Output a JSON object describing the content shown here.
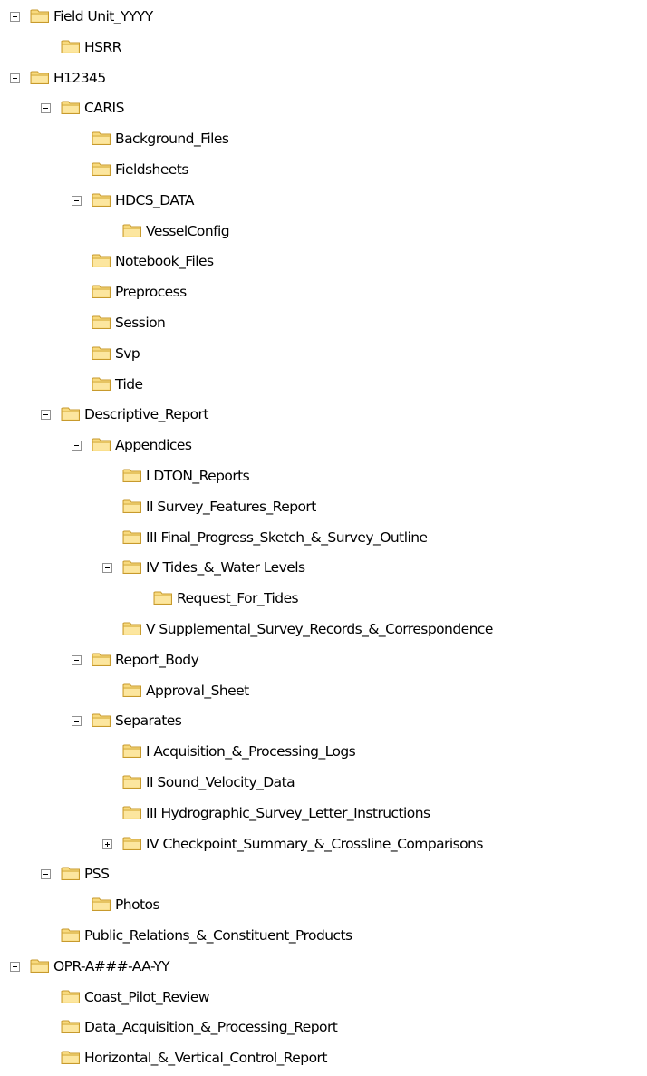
{
  "tree": [
    {
      "depth": 0,
      "state": "expanded",
      "label": "Field Unit_YYYY",
      "icon": "folder-icon"
    },
    {
      "depth": 1,
      "state": "leaf",
      "label": "HSRR",
      "icon": "folder-icon"
    },
    {
      "depth": 0,
      "state": "expanded",
      "label": "H12345",
      "icon": "folder-icon"
    },
    {
      "depth": 1,
      "state": "expanded",
      "label": "CARIS",
      "icon": "folder-icon"
    },
    {
      "depth": 2,
      "state": "leaf",
      "label": "Background_Files",
      "icon": "folder-icon"
    },
    {
      "depth": 2,
      "state": "leaf",
      "label": "Fieldsheets",
      "icon": "folder-icon"
    },
    {
      "depth": 2,
      "state": "expanded",
      "label": "HDCS_DATA",
      "icon": "folder-icon"
    },
    {
      "depth": 3,
      "state": "leaf",
      "label": "VesselConfig",
      "icon": "folder-icon"
    },
    {
      "depth": 2,
      "state": "leaf",
      "label": "Notebook_Files",
      "icon": "folder-icon"
    },
    {
      "depth": 2,
      "state": "leaf",
      "label": "Preprocess",
      "icon": "folder-icon"
    },
    {
      "depth": 2,
      "state": "leaf",
      "label": "Session",
      "icon": "folder-icon"
    },
    {
      "depth": 2,
      "state": "leaf",
      "label": "Svp",
      "icon": "folder-icon"
    },
    {
      "depth": 2,
      "state": "leaf",
      "label": "Tide",
      "icon": "folder-icon"
    },
    {
      "depth": 1,
      "state": "expanded",
      "label": "Descriptive_Report",
      "icon": "folder-icon"
    },
    {
      "depth": 2,
      "state": "expanded",
      "label": "Appendices",
      "icon": "folder-icon"
    },
    {
      "depth": 3,
      "state": "leaf",
      "label": "I DTON_Reports",
      "icon": "folder-icon"
    },
    {
      "depth": 3,
      "state": "leaf",
      "label": "II Survey_Features_Report",
      "icon": "folder-icon"
    },
    {
      "depth": 3,
      "state": "leaf",
      "label": "III Final_Progress_Sketch_&_Survey_Outline",
      "icon": "folder-icon"
    },
    {
      "depth": 3,
      "state": "expanded",
      "label": "IV Tides_&_Water Levels",
      "icon": "folder-icon"
    },
    {
      "depth": 4,
      "state": "leaf",
      "label": "Request_For_Tides",
      "icon": "folder-icon"
    },
    {
      "depth": 3,
      "state": "leaf",
      "label": "V Supplemental_Survey_Records_&_Correspondence",
      "icon": "folder-icon"
    },
    {
      "depth": 2,
      "state": "expanded",
      "label": "Report_Body",
      "icon": "folder-icon"
    },
    {
      "depth": 3,
      "state": "leaf",
      "label": "Approval_Sheet",
      "icon": "folder-icon"
    },
    {
      "depth": 2,
      "state": "expanded",
      "label": "Separates",
      "icon": "folder-icon"
    },
    {
      "depth": 3,
      "state": "leaf",
      "label": "I Acquisition_&_Processing_Logs",
      "icon": "folder-icon"
    },
    {
      "depth": 3,
      "state": "leaf",
      "label": "II Sound_Velocity_Data",
      "icon": "folder-icon"
    },
    {
      "depth": 3,
      "state": "leaf",
      "label": "III Hydrographic_Survey_Letter_Instructions",
      "icon": "folder-icon"
    },
    {
      "depth": 3,
      "state": "collapsed",
      "label": "IV Checkpoint_Summary_&_Crossline_Comparisons",
      "icon": "folder-icon"
    },
    {
      "depth": 1,
      "state": "expanded",
      "label": "PSS",
      "icon": "folder-icon"
    },
    {
      "depth": 2,
      "state": "leaf",
      "label": "Photos",
      "icon": "folder-icon"
    },
    {
      "depth": 1,
      "state": "leaf",
      "label": "Public_Relations_&_Constituent_Products",
      "icon": "folder-icon"
    },
    {
      "depth": 0,
      "state": "expanded",
      "label": "OPR-A###-AA-YY",
      "icon": "folder-icon"
    },
    {
      "depth": 1,
      "state": "leaf",
      "label": "Coast_Pilot_Review",
      "icon": "folder-icon"
    },
    {
      "depth": 1,
      "state": "leaf",
      "label": "Data_Acquisition_&_Processing_Report",
      "icon": "folder-icon"
    },
    {
      "depth": 1,
      "state": "leaf",
      "label": "Horizontal_&_Vertical_Control_Report",
      "icon": "folder-icon"
    }
  ],
  "colors": {
    "folder_fill": "#F8DA7E",
    "folder_outline": "#C79A2D",
    "expander_border": "#919191",
    "expander_glyph": "#000000"
  }
}
